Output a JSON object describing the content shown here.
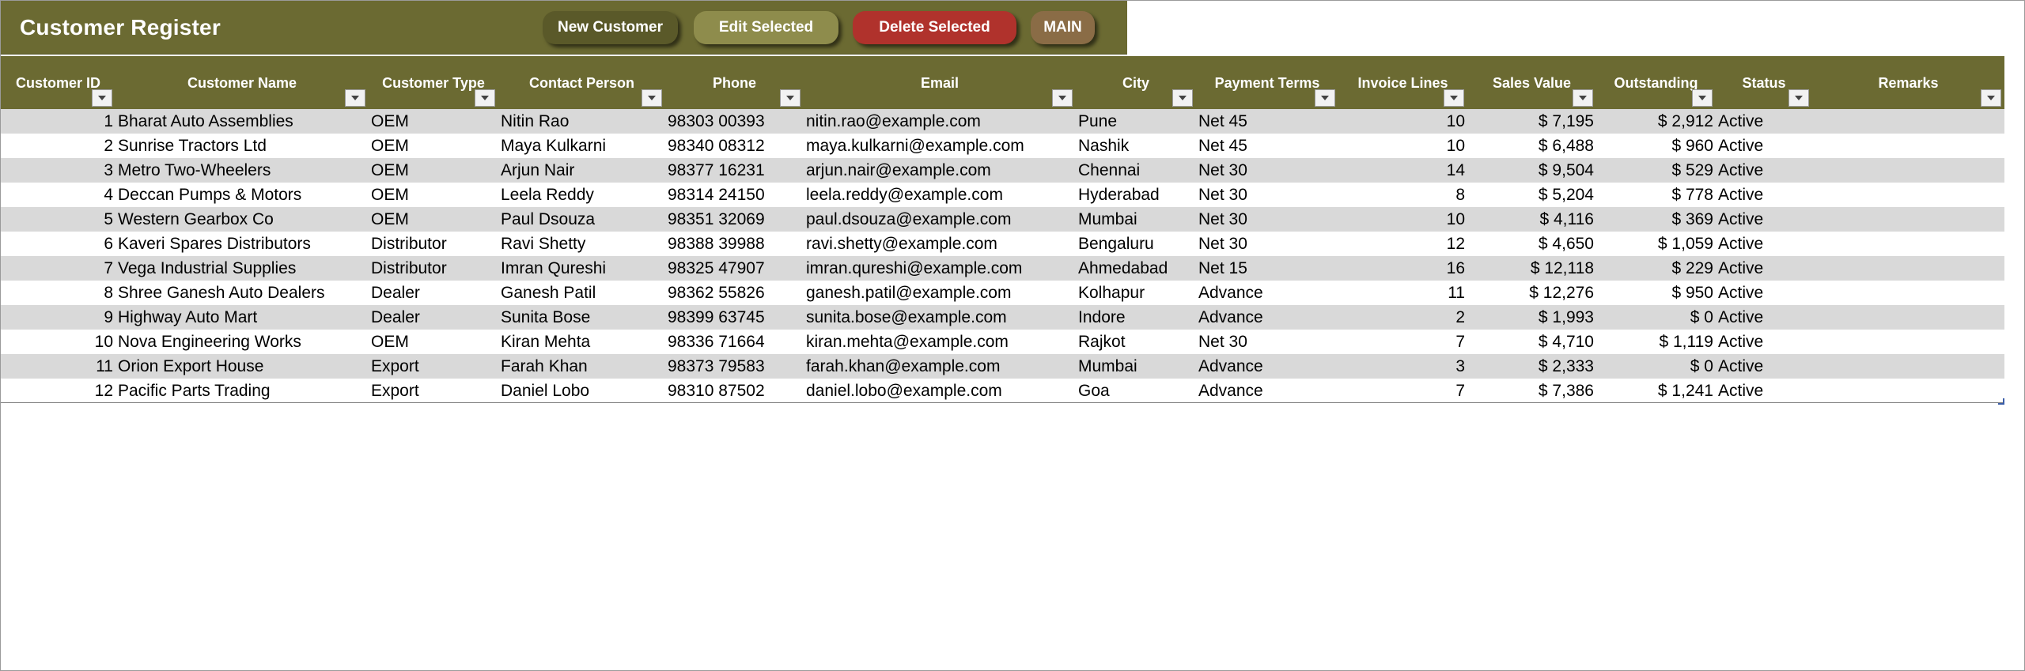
{
  "header": {
    "title": "Customer Register",
    "buttons": {
      "new": "New Customer",
      "edit": "Edit Selected",
      "delete": "Delete Selected",
      "main": "MAIN"
    }
  },
  "colors": {
    "banner": "#6b6a32",
    "new_button": "#5a5929",
    "edit_button": "#8e8c4c",
    "delete_button": "#b0322c",
    "main_button": "#8a6c46",
    "row_band": "#d9d9d9"
  },
  "icons": {
    "filter": "dropdown-arrow-icon"
  },
  "table": {
    "columns": [
      "Customer ID",
      "Customer Name",
      "Customer Type",
      "Contact Person",
      "Phone",
      "Email",
      "City",
      "Payment Terms",
      "Invoice Lines",
      "Sales Value",
      "Outstanding",
      "Status",
      "Remarks"
    ],
    "rows": [
      [
        "1",
        "Bharat Auto Assemblies",
        "OEM",
        "Nitin Rao",
        "98303 00393",
        "nitin.rao@example.com",
        "Pune",
        "Net 45",
        "10",
        "$ 7,195",
        "$ 2,912",
        "Active",
        ""
      ],
      [
        "2",
        "Sunrise Tractors Ltd",
        "OEM",
        "Maya Kulkarni",
        "98340 08312",
        "maya.kulkarni@example.com",
        "Nashik",
        "Net 45",
        "10",
        "$ 6,488",
        "$ 960",
        "Active",
        ""
      ],
      [
        "3",
        "Metro Two-Wheelers",
        "OEM",
        "Arjun Nair",
        "98377 16231",
        "arjun.nair@example.com",
        "Chennai",
        "Net 30",
        "14",
        "$ 9,504",
        "$ 529",
        "Active",
        ""
      ],
      [
        "4",
        "Deccan Pumps & Motors",
        "OEM",
        "Leela Reddy",
        "98314 24150",
        "leela.reddy@example.com",
        "Hyderabad",
        "Net 30",
        "8",
        "$ 5,204",
        "$ 778",
        "Active",
        ""
      ],
      [
        "5",
        "Western Gearbox Co",
        "OEM",
        "Paul Dsouza",
        "98351 32069",
        "paul.dsouza@example.com",
        "Mumbai",
        "Net 30",
        "10",
        "$ 4,116",
        "$ 369",
        "Active",
        ""
      ],
      [
        "6",
        "Kaveri Spares Distributors",
        "Distributor",
        "Ravi Shetty",
        "98388 39988",
        "ravi.shetty@example.com",
        "Bengaluru",
        "Net 30",
        "12",
        "$ 4,650",
        "$ 1,059",
        "Active",
        ""
      ],
      [
        "7",
        "Vega Industrial Supplies",
        "Distributor",
        "Imran Qureshi",
        "98325 47907",
        "imran.qureshi@example.com",
        "Ahmedabad",
        "Net 15",
        "16",
        "$ 12,118",
        "$ 229",
        "Active",
        ""
      ],
      [
        "8",
        "Shree Ganesh Auto Dealers",
        "Dealer",
        "Ganesh Patil",
        "98362 55826",
        "ganesh.patil@example.com",
        "Kolhapur",
        "Advance",
        "11",
        "$ 12,276",
        "$ 950",
        "Active",
        ""
      ],
      [
        "9",
        "Highway Auto Mart",
        "Dealer",
        "Sunita Bose",
        "98399 63745",
        "sunita.bose@example.com",
        "Indore",
        "Advance",
        "2",
        "$ 1,993",
        "$ 0",
        "Active",
        ""
      ],
      [
        "10",
        "Nova Engineering Works",
        "OEM",
        "Kiran Mehta",
        "98336 71664",
        "kiran.mehta@example.com",
        "Rajkot",
        "Net 30",
        "7",
        "$ 4,710",
        "$ 1,119",
        "Active",
        ""
      ],
      [
        "11",
        "Orion Export House",
        "Export",
        "Farah Khan",
        "98373 79583",
        "farah.khan@example.com",
        "Mumbai",
        "Advance",
        "3",
        "$ 2,333",
        "$ 0",
        "Active",
        ""
      ],
      [
        "12",
        "Pacific Parts Trading",
        "Export",
        "Daniel Lobo",
        "98310 87502",
        "daniel.lobo@example.com",
        "Goa",
        "Advance",
        "7",
        "$ 7,386",
        "$ 1,241",
        "Active",
        ""
      ]
    ]
  }
}
